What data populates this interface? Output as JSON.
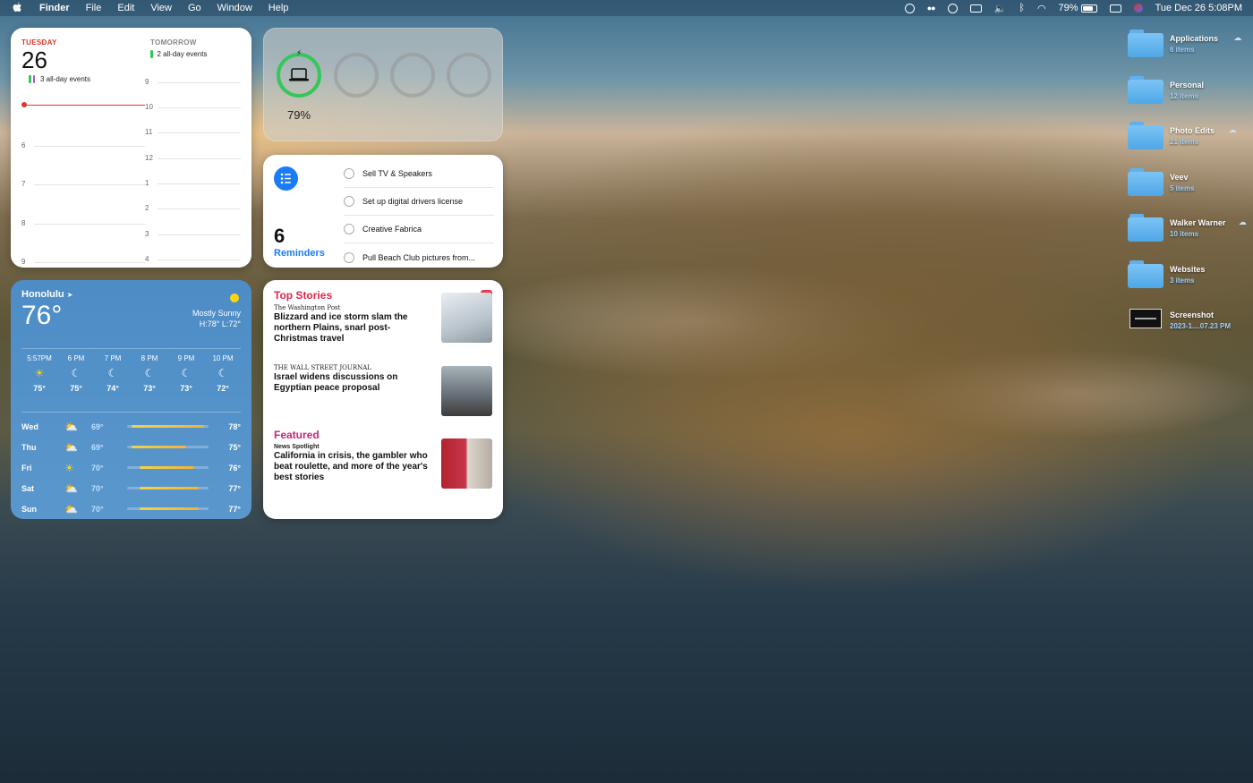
{
  "menubar": {
    "app": "Finder",
    "menus": [
      "File",
      "Edit",
      "View",
      "Go",
      "Window",
      "Help"
    ],
    "battery": "79%",
    "datetime": "Tue Dec 26  5:08PM"
  },
  "calendar": {
    "today_label": "TUESDAY",
    "today_num": "26",
    "today_events": "3 all-day events",
    "tomorrow_label": "TOMORROW",
    "tomorrow_events": "2 all-day events",
    "hours_today": [
      "6",
      "7",
      "8",
      "9"
    ],
    "hours_tomorrow": [
      "9",
      "10",
      "11",
      "12",
      "1",
      "2",
      "3",
      "4"
    ],
    "colors": {
      "accent": "#e0342c",
      "event_green": "#34c759",
      "event_purple": "#a358d8"
    }
  },
  "battery_widget": {
    "percent": "79%",
    "level": 0.79,
    "ring_color": "#34c759"
  },
  "reminders": {
    "count": "6",
    "label": "Reminders",
    "items": [
      "Sell TV & Speakers",
      "Set up digital drivers license",
      "Creative Fabrica",
      "Pull Beach Club pictures from..."
    ]
  },
  "weather": {
    "city": "Honolulu",
    "temp": "76°",
    "condition": "Mostly Sunny",
    "hilo": "H:78° L:72°",
    "hourly": [
      {
        "time": "5:57PM",
        "icon": "sunset-icon",
        "temp": "75°"
      },
      {
        "time": "6 PM",
        "icon": "moon-icon",
        "temp": "75°"
      },
      {
        "time": "7 PM",
        "icon": "moon-icon",
        "temp": "74°"
      },
      {
        "time": "8 PM",
        "icon": "moon-icon",
        "temp": "73°"
      },
      {
        "time": "9 PM",
        "icon": "moon-icon",
        "temp": "73°"
      },
      {
        "time": "10 PM",
        "icon": "moon-icon",
        "temp": "72°"
      }
    ],
    "daily": [
      {
        "day": "Wed",
        "icon": "partly-cloudy-icon",
        "lo": "69°",
        "hi": "78°",
        "bar_from": 0.05,
        "bar_to": 0.95
      },
      {
        "day": "Thu",
        "icon": "partly-cloudy-icon",
        "lo": "69°",
        "hi": "75°",
        "bar_from": 0.05,
        "bar_to": 0.72
      },
      {
        "day": "Fri",
        "icon": "sun-icon",
        "lo": "70°",
        "hi": "76°",
        "bar_from": 0.15,
        "bar_to": 0.82
      },
      {
        "day": "Sat",
        "icon": "partly-cloudy-icon",
        "lo": "70°",
        "hi": "77°",
        "bar_from": 0.15,
        "bar_to": 0.88
      },
      {
        "day": "Sun",
        "icon": "partly-cloudy-icon",
        "lo": "70°",
        "hi": "77°",
        "bar_from": 0.15,
        "bar_to": 0.88
      }
    ]
  },
  "news": {
    "top_label": "Top Stories",
    "featured_label": "Featured",
    "stories": [
      {
        "publisher": "The Washington Post",
        "headline": "Blizzard and ice storm slam the northern Plains, snarl post-Christmas travel"
      },
      {
        "publisher": "THE WALL STREET JOURNAL",
        "headline": "Israel widens discussions on Egyptian peace proposal"
      }
    ],
    "featured": {
      "publisher": "News Spotlight",
      "headline": "California in crisis, the gambler who beat roulette, and more of the year's best stories"
    }
  },
  "desktop": [
    {
      "name": "Applications",
      "sub": "6 items",
      "kind": "folder",
      "cloud": true
    },
    {
      "name": "Personal",
      "sub": "12 items",
      "kind": "folder",
      "cloud": false
    },
    {
      "name": "Photo Edits",
      "sub": "21 items",
      "kind": "folder",
      "cloud": true
    },
    {
      "name": "Veev",
      "sub": "5 items",
      "kind": "folder",
      "cloud": false
    },
    {
      "name": "Walker Warner",
      "sub": "10 items",
      "kind": "folder",
      "cloud": true
    },
    {
      "name": "Websites",
      "sub": "3 items",
      "kind": "folder",
      "cloud": false
    },
    {
      "name": "Screenshot",
      "sub": "2023-1....07.23 PM",
      "kind": "image",
      "cloud": false
    }
  ]
}
